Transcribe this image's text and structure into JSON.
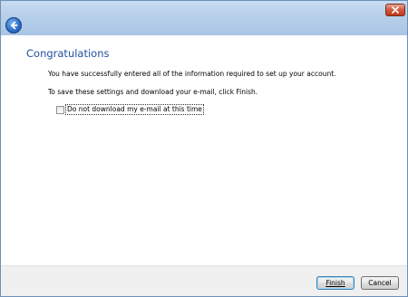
{
  "header": {
    "back_icon": "back-arrow-icon",
    "close_icon": "close-x-icon"
  },
  "main": {
    "title": "Congratulations",
    "message": "You have successfully entered all of the information required to set up your account.",
    "instruction": "To save these settings and download your e-mail, click Finish.",
    "checkbox": {
      "label": "Do not download my e-mail at this time",
      "checked": false
    }
  },
  "footer": {
    "finish_label": "Finish",
    "cancel_label": "Cancel"
  },
  "colors": {
    "heading": "#1f4e9c",
    "titlebar": "#b6cfea",
    "close": "#c3391d"
  }
}
